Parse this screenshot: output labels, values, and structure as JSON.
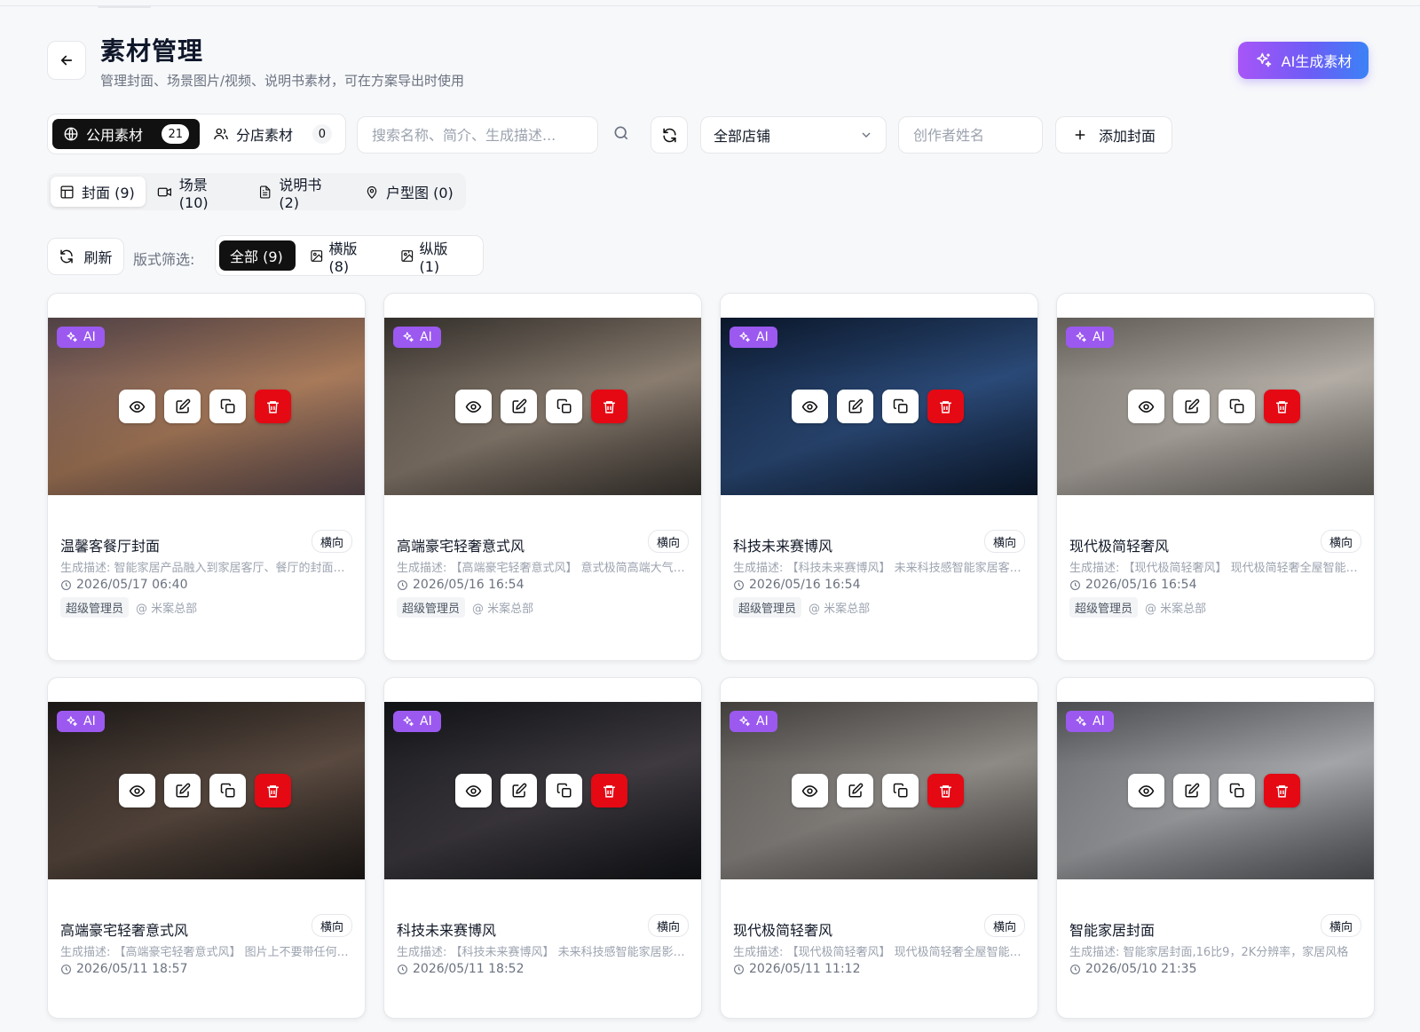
{
  "header": {
    "title": "素材管理",
    "subtitle": "管理封面、场景图片/视频、说明书素材，可在方案导出时使用",
    "ai_button": "AI生成素材"
  },
  "scope_tabs": [
    {
      "label": "公用素材",
      "count": "21",
      "active": true
    },
    {
      "label": "分店素材",
      "count": "0",
      "active": false
    }
  ],
  "search": {
    "placeholder": "搜索名称、简介、生成描述..."
  },
  "store_select": {
    "value": "全部店铺"
  },
  "author": {
    "placeholder": "创作者姓名"
  },
  "add_cover": "添加封面",
  "type_tabs": [
    "封面 (9)",
    "场景 (10)",
    "说明书 (2)",
    "户型图 (0)"
  ],
  "refresh_label": "刷新",
  "layout_label": "版式筛选:",
  "layout_tabs": [
    "全部 (9)",
    "横版 (8)",
    "纵版 (1)"
  ],
  "ai_badge": "AI",
  "cards": [
    {
      "title": "温馨客餐厅封面",
      "orientation": "横向",
      "desc": "生成描述: 智能家居产品融入到家居客厅、餐厅的封面，温馨舒适的氛围",
      "time": "2026/05/17 06:40",
      "role": "超级管理员",
      "org": "@ 米案总部",
      "c1": "#5b4a4f",
      "c2": "#a87a5a"
    },
    {
      "title": "高端豪宅轻奢意式风",
      "orientation": "横向",
      "desc": "生成描述: 【高端豪宅轻奢意式风】 意式极简高端大气的客厅",
      "time": "2026/05/16 16:54",
      "role": "超级管理员",
      "org": "@ 米案总部",
      "c1": "#3a3530",
      "c2": "#8a7d70"
    },
    {
      "title": "科技未来赛博风",
      "orientation": "横向",
      "desc": "生成描述: 【科技未来赛博风】 未来科技感智能家居客厅设计",
      "time": "2026/05/16 16:54",
      "role": "超级管理员",
      "org": "@ 米案总部",
      "c1": "#0c1a30",
      "c2": "#2b4a78"
    },
    {
      "title": "现代极简轻奢风",
      "orientation": "横向",
      "desc": "生成描述: 【现代极简轻奢风】 现代极简轻奢全屋智能设计方案",
      "time": "2026/05/16 16:54",
      "role": "超级管理员",
      "org": "@ 米案总部",
      "c1": "#6f6a64",
      "c2": "#b3ada6"
    },
    {
      "title": "高端豪宅轻奢意式风",
      "orientation": "横向",
      "desc": "生成描述: 【高端豪宅轻奢意式风】 图片上不要带任何文字",
      "time": "2026/05/11 18:57",
      "role": "",
      "org": "",
      "c1": "#1e1a18",
      "c2": "#5a4a40"
    },
    {
      "title": "科技未来赛博风",
      "orientation": "横向",
      "desc": "生成描述: 【科技未来赛博风】 未来科技感智能家居影音室",
      "time": "2026/05/11 18:52",
      "role": "",
      "org": "",
      "c1": "#121418",
      "c2": "#3e3a40"
    },
    {
      "title": "现代极简轻奢风",
      "orientation": "横向",
      "desc": "生成描述: 【现代极简轻奢风】 现代极简轻奢全屋智能客厅",
      "time": "2026/05/11 11:12",
      "role": "",
      "org": "",
      "c1": "#4a4744",
      "c2": "#8e8a86"
    },
    {
      "title": "智能家居封面",
      "orientation": "横向",
      "desc": "生成描述: 智能家居封面,16比9，2K分辨率，家居风格",
      "time": "2026/05/10 21:35",
      "role": "",
      "org": "",
      "c1": "#55575b",
      "c2": "#a3a5a8"
    }
  ]
}
